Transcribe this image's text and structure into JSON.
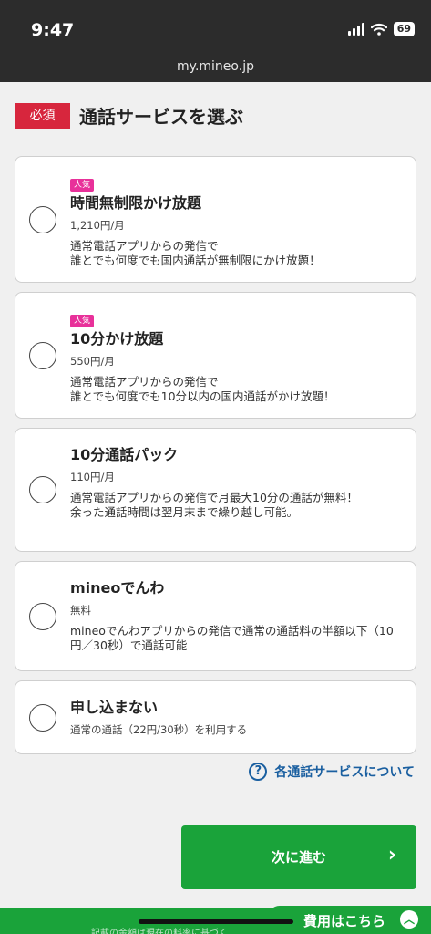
{
  "status_bar": {
    "time": "9:47",
    "battery": "69"
  },
  "browser": {
    "url": "my.mineo.jp"
  },
  "section": {
    "required_label": "必須",
    "title": "通話サービスを選ぶ"
  },
  "options": [
    {
      "badge": "人気",
      "title": "時間無制限かけ放題",
      "price": "1,210円/月",
      "description": "通常電話アプリからの発信で\n誰とでも何度でも国内通話が無制限にかけ放題！",
      "selected": false
    },
    {
      "badge": "人気",
      "title": "10分かけ放題",
      "price": "550円/月",
      "description": "通常電話アプリからの発信で\n誰とでも何度でも10分以内の国内通話がかけ放題！",
      "selected": false
    },
    {
      "title": "10分通話パック",
      "price": "110円/月",
      "description": "通常電話アプリからの発信で月最大10分の通話が無料！\n余った通話時間は翌月末まで繰り越し可能。",
      "selected": false
    },
    {
      "title": "mineoでんわ",
      "price": "無料",
      "description": "mineoでんわアプリからの発信で通常の通話料の半額以下（10円／30秒）で通話可能",
      "selected": false
    },
    {
      "title": "申し込まない",
      "price": "通常の通話（22円/30秒）を利用する",
      "selected": false
    }
  ],
  "help": {
    "icon": "question-circle-icon",
    "label": "各通話サービスについて"
  },
  "next_button": {
    "label": "次に進む",
    "icon": "chevron-right-icon"
  },
  "cost_tab": {
    "label": "費用はこちら",
    "icon": "chevron-up-icon"
  },
  "footer": {
    "note": "記載の金額は現在の料率に基づく"
  },
  "colors": {
    "accent_green": "#1aa33a",
    "required_red": "#d7263d",
    "popular_pink": "#e8319a",
    "link_blue": "#1a5fa0"
  }
}
